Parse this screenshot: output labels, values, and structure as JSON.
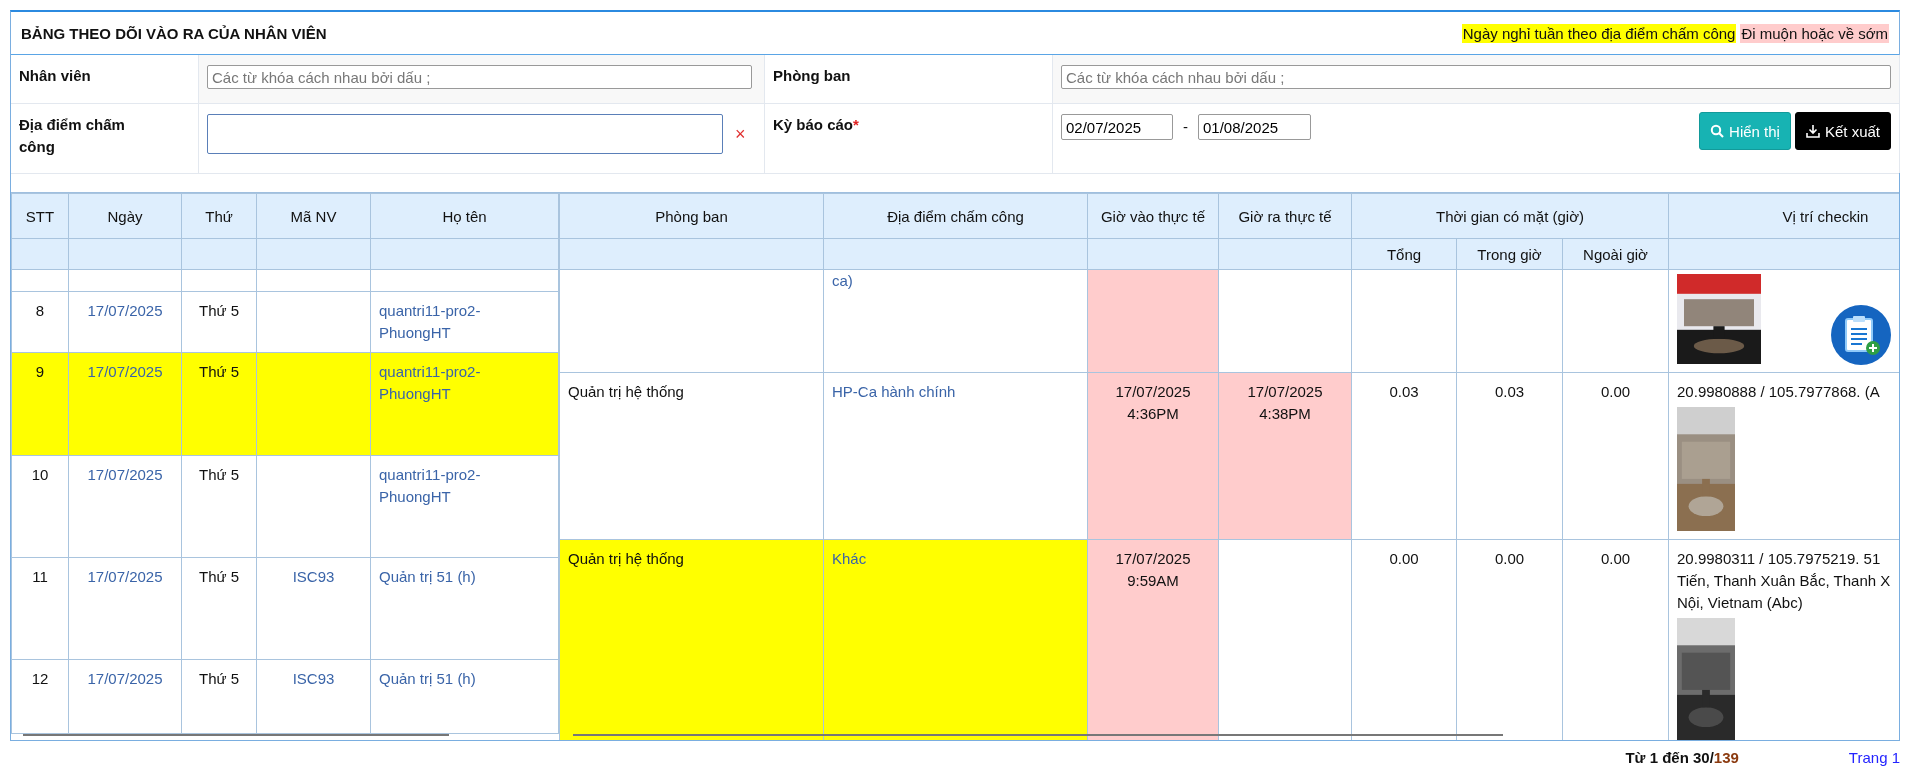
{
  "title": "BẢNG THEO DÕI VÀO RA CỦA NHÂN VIÊN",
  "legend": [
    {
      "label": "Ngày nghỉ tuần theo địa điểm chấm công",
      "color": "#ffff00"
    },
    {
      "label": "Đi muộn hoặc về sớm",
      "color": "#ffcccc"
    }
  ],
  "filters": {
    "employee": {
      "label": "Nhân viên",
      "placeholder": "Các từ khóa cách nhau bởi dấu ;"
    },
    "department": {
      "label": "Phòng ban",
      "placeholder": "Các từ khóa cách nhau bởi dấu ;"
    },
    "location": {
      "label": "Địa điểm chấm công",
      "clear": "×"
    },
    "period": {
      "label": "Kỳ báo cáo",
      "required_mark": "*",
      "from": "02/07/2025",
      "separator": "-",
      "to": "01/08/2025"
    }
  },
  "buttons": [
    {
      "kind": "search",
      "label": "Hiển thị"
    },
    {
      "kind": "export",
      "label": "Kết xuất"
    }
  ],
  "table": {
    "left_columns": [
      "STT",
      "Ngày",
      "Thứ",
      "Mã NV",
      "Họ tên"
    ],
    "right_columns": [
      {
        "kind": "single",
        "label": "Phòng ban"
      },
      {
        "kind": "single",
        "label": "Địa điểm chấm công"
      },
      {
        "kind": "single",
        "label": "Giờ vào thực tế"
      },
      {
        "kind": "single",
        "label": "Giờ ra thực tế"
      },
      {
        "kind": "group",
        "label": "Thời gian có mặt (giờ)",
        "children": [
          "Tổng",
          "Trong giờ",
          "Ngoài giờ"
        ]
      },
      {
        "kind": "single",
        "label": "Vị trí checkin"
      }
    ],
    "left_rows": [
      {
        "stt": "8",
        "date": "17/07/2025",
        "weekday": "Thứ 5",
        "name": "quantri11-pro2-PhuongHT",
        "rest_day": false
      },
      {
        "stt": "9",
        "date": "17/07/2025",
        "weekday": "Thứ 5",
        "name": "quantri11-pro2-PhuongHT",
        "rest_day": true
      },
      {
        "stt": "10",
        "date": "17/07/2025",
        "weekday": "Thứ 5",
        "name": "quantri11-pro2-PhuongHT",
        "rest_day": false
      },
      {
        "stt": "11",
        "date": "17/07/2025",
        "weekday": "Thứ 5",
        "code": "ISC93",
        "name": "Quản trị 51 (h)",
        "rest_day": false
      },
      {
        "stt": "12",
        "date": "17/07/2025",
        "weekday": "Thứ 5",
        "code": "ISC93",
        "name": "Quản trị 51 (h)",
        "rest_day": false
      }
    ],
    "right_rows": [
      {
        "location": "ca)",
        "check_in_late": true,
        "check_out_late": false,
        "rest_day": false,
        "position": [],
        "photo": {
          "kind": "picture"
        }
      },
      {
        "department": "Quản trị hệ thống",
        "location": "HP-Ca hành chính",
        "check_in": [
          "17/07/2025",
          "4:36PM"
        ],
        "check_out": [
          "17/07/2025",
          "4:38PM"
        ],
        "check_in_late": true,
        "check_out_late": true,
        "total": "0.03",
        "in_hours": "0.03",
        "overtime": "0.00",
        "rest_day": false,
        "position": [
          "20.9980888 / 105.7977868. (A"
        ],
        "photo": {
          "kind": "picture"
        }
      },
      {
        "department": "Quản trị hệ thống",
        "location": "Khác",
        "check_in": [
          "17/07/2025",
          "9:59AM"
        ],
        "check_in_late": true,
        "check_out_late": false,
        "total": "0.00",
        "in_hours": "0.00",
        "overtime": "0.00",
        "rest_day": true,
        "position": [
          "20.9980311 / 105.7975219. 51",
          "Tiến, Thanh Xuân Bắc, Thanh X",
          "Nội, Vietnam (Abc)"
        ],
        "photo": {
          "kind": "picture"
        }
      }
    ]
  },
  "footer": {
    "range": "Từ 1 đến 30/",
    "total": "139",
    "page": "Trang 1"
  }
}
